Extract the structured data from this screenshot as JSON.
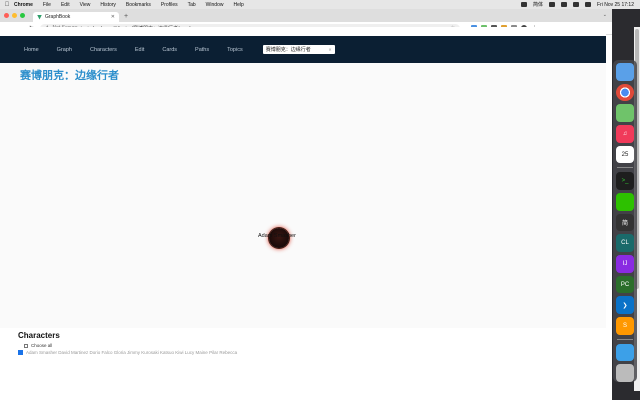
{
  "menubar": {
    "items": [
      "Chrome",
      "File",
      "Edit",
      "View",
      "History",
      "Bookmarks",
      "Profiles",
      "Tab",
      "Window",
      "Help"
    ],
    "clock": "Fri Nov 25  17:12",
    "input_method": "简体"
  },
  "browser": {
    "tab_title": "GraphBook",
    "security_label": "Not Secure",
    "url": "topic-land.com/#/topics/赛博朋克：边缘行者/graph"
  },
  "site_nav": {
    "links": [
      "Home",
      "Graph",
      "Characters",
      "Edit",
      "Cards",
      "Paths",
      "Topics"
    ],
    "search_value": "赛博朋克：边缘行者"
  },
  "graph": {
    "title": "赛博朋克：边缘行者",
    "node_label": "Adam Smasher"
  },
  "characters": {
    "heading": "Characters",
    "choose_all_label": "Choose all",
    "items_preview": "Adam Smasher    David Martinez    Dorio    Falco    Gloria    Jimmy Kurosaki    Katsuo    Kiwi    Lucy    Maine    Pilar    Rebecca"
  },
  "dock": {
    "icons": [
      "finder-icon",
      "chrome-icon",
      "maps-icon",
      "music-icon",
      "calendar-icon",
      "terminal-icon",
      "wechat-icon",
      "input-method-icon",
      "clion-icon",
      "intellij-icon",
      "pycharm-icon",
      "vscode-icon",
      "sublime-icon",
      "downloads-icon",
      "trash-icon"
    ],
    "calendar_day": "25"
  }
}
